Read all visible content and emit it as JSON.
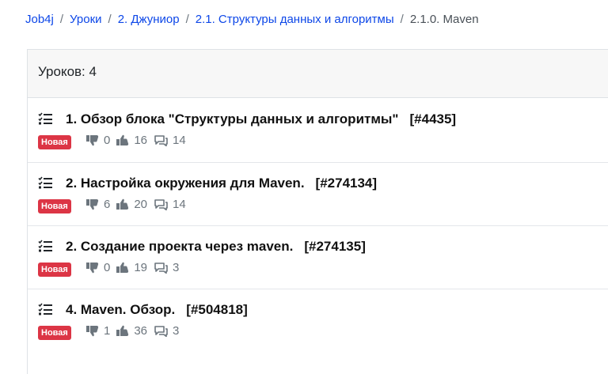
{
  "breadcrumb": {
    "items": [
      "Job4j",
      "Уроки",
      "2. Джуниор",
      "2.1. Структуры данных и алгоритмы"
    ],
    "separator": "/",
    "current": "2.1.0. Maven"
  },
  "header": {
    "lessons_count": "Уроков: 4"
  },
  "lessons": [
    {
      "title": "1. Обзор блока \"Структуры данных и алгоритмы\"",
      "id": "[#4435]",
      "badge": "Новая",
      "dislikes": "0",
      "likes": "16",
      "comments": "14"
    },
    {
      "title": "2. Настройка окружения для Maven.",
      "id": "[#274134]",
      "badge": "Новая",
      "dislikes": "6",
      "likes": "20",
      "comments": "14"
    },
    {
      "title": "2. Создание проекта через maven.",
      "id": "[#274135]",
      "badge": "Новая",
      "dislikes": "0",
      "likes": "19",
      "comments": "3"
    },
    {
      "title": "4. Maven. Обзор.",
      "id": "[#504818]",
      "badge": "Новая",
      "dislikes": "1",
      "likes": "36",
      "comments": "3"
    }
  ],
  "icons": {
    "list": "tasks-list-icon",
    "dislike": "thumbs-down-icon",
    "like": "thumbs-up-icon",
    "comments": "comments-icon"
  },
  "colors": {
    "link": "#0d47e8",
    "badge": "#dc3545"
  }
}
